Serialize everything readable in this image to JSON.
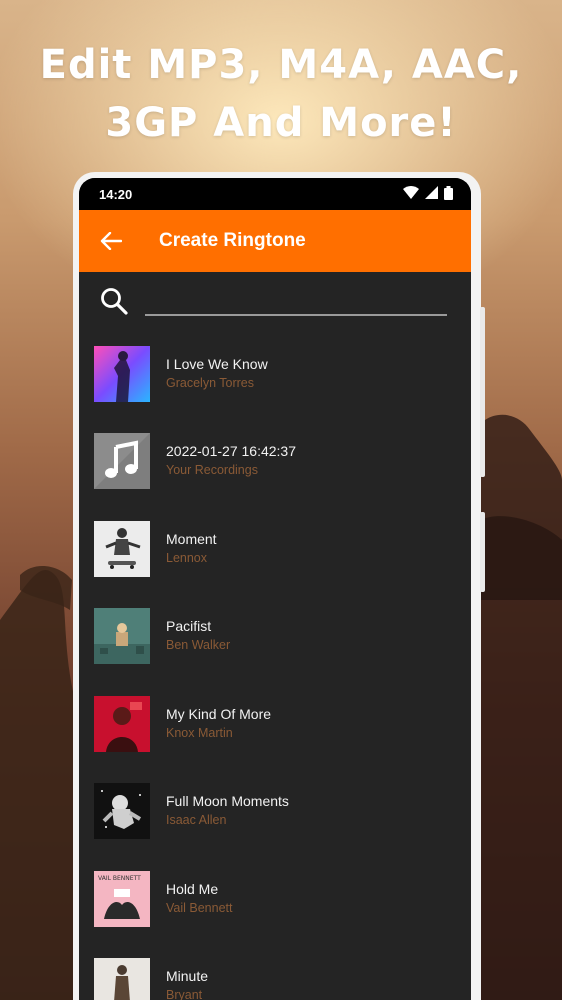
{
  "promo": {
    "line1": "Edit MP3, M4A, AAC,",
    "line2": "3GP And More!"
  },
  "status_bar": {
    "time": "14:20",
    "icons": [
      "wifi-icon",
      "signal-icon",
      "battery-icon"
    ]
  },
  "app_bar": {
    "title": "Create Ringtone",
    "back_icon": "arrow-back-icon",
    "color": "#ff6f00"
  },
  "search": {
    "icon": "search-icon",
    "value": "",
    "placeholder": ""
  },
  "songs": [
    {
      "title": "I Love We Know",
      "artist": "Gracelyn Torres",
      "art": "concert-pink-blue"
    },
    {
      "title": "2022-01-27 16:42:37",
      "artist": "Your Recordings",
      "art": "music-note-placeholder"
    },
    {
      "title": "Moment",
      "artist": "Lennox",
      "art": "skater-monochrome"
    },
    {
      "title": "Pacifist",
      "artist": "Ben Walker",
      "art": "teal-scene"
    },
    {
      "title": "My Kind Of More",
      "artist": "Knox Martin",
      "art": "red-portrait"
    },
    {
      "title": "Full Moon Moments",
      "artist": "Isaac Allen",
      "art": "astronaut-dark"
    },
    {
      "title": "Hold Me",
      "artist": "Vail Bennett",
      "art": "pink-hands",
      "art_text": "VAIL BENNETT"
    },
    {
      "title": "Minute",
      "artist": "Bryant",
      "art": "figure-light"
    }
  ],
  "colors": {
    "accent": "#ff6f00",
    "list_background": "#242424",
    "artist_text": "#8a5a36"
  }
}
